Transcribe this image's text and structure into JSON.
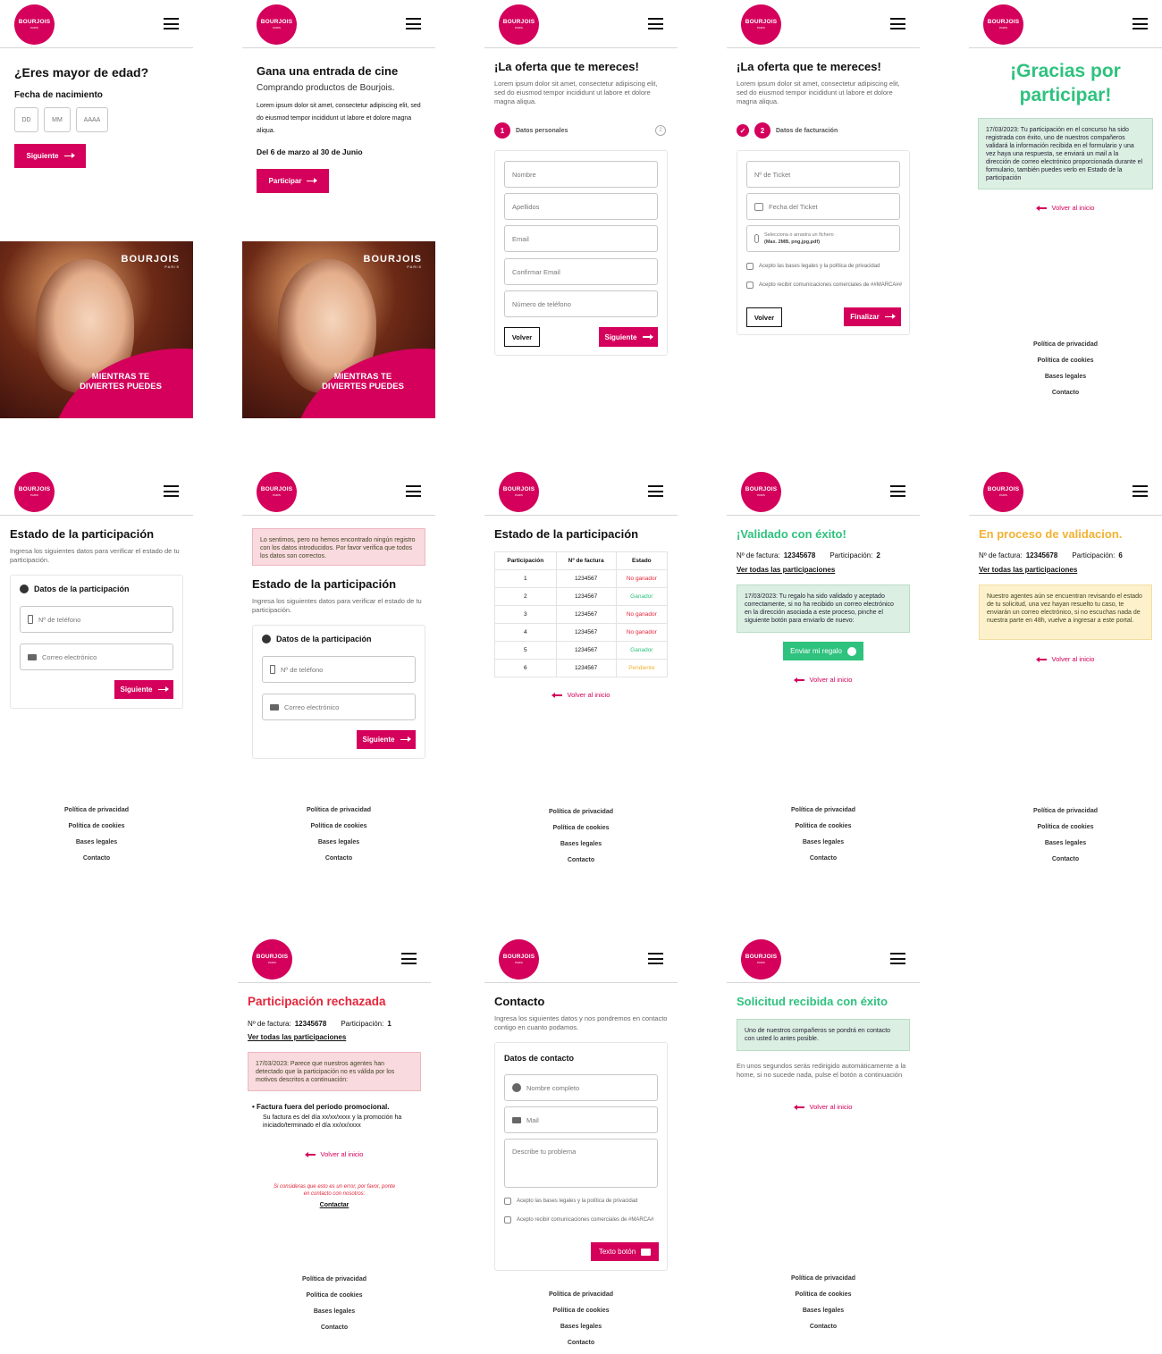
{
  "brand": {
    "logo_text": "BOURJOIS",
    "logo_sub": "PARIS",
    "accent": "#d4005b",
    "success": "#2ec27e",
    "warning": "#f2b233",
    "error": "#e3253a"
  },
  "footer": [
    "Política de privacidad",
    "Política de cookies",
    "Bases legales",
    "Contacto"
  ],
  "back_link": "Volver al inicio",
  "age": {
    "title": "¿Eres mayor de edad?",
    "label": "Fecha de nacimiento",
    "dd": "DD",
    "mm": "MM",
    "aaaa": "AAAA",
    "next": "Siguiente"
  },
  "promo": {
    "brand": "BOURJOIS",
    "brand_sub": "PARIS",
    "slogan": "MIENTRAS TE DIVIERTES PUEDES"
  },
  "cine": {
    "title": "Gana una entrada de cine",
    "subtitle": "Comprando productos de Bourjois.",
    "body": "Lorem ipsum dolor sit amet, consectetur adipiscing elit, sed do eiusmod tempor incididunt ut labore et dolore magna aliqua.",
    "dates": "Del 6 de marzo al 30 de Junio",
    "cta": "Participar"
  },
  "offer": {
    "title": "¡La oferta que te mereces!",
    "body": "Lorem ipsum dolor sit amet, consectetur adipiscing elit, sed do eiusmod tempor incididunt ut labore et dolore magna aliqua.",
    "step1_num": "1",
    "step1_label": "Datos personales",
    "step2_num": "2",
    "step2_label": "Datos de facturación",
    "fields": [
      "Nombre",
      "Apellidos",
      "Email",
      "Confirmar Email",
      "Número de teléfono"
    ],
    "back": "Volver",
    "next": "Siguiente"
  },
  "billing": {
    "ticket": "Nº de Ticket",
    "ticket_date": "Fecha del Ticket",
    "file_line1": "Selecciona o arrastra un fichero",
    "file_line2": "(Max. 2MB, png,jpg,pdf)",
    "legal": "Acepto las bases legales y la política de privacidad",
    "comms": "Acepto recibir comunicaciones comerciales de ##MARCA##",
    "back": "Volver",
    "finish": "Finalizar"
  },
  "thanks": {
    "title": "¡Gracias por participar!",
    "note": "17/03/2023: Tu participación en el concurso ha sido registrada con éxito, uno de nuestros compañeros validará la información recibida en el formulario y una vez haya una respuesta, se enviará un mail a la dirección de correo electrónico proporcionada durante el formulario, también puedes verlo en Estado de la participación"
  },
  "status": {
    "title": "Estado de la participación",
    "body": "Ingresa los siguientes datos para verificar el estado de tu participación.",
    "card_title": "Datos de la participación",
    "phone": "Nº de teléfono",
    "email": "Correo electrónico",
    "next": "Siguiente"
  },
  "status_error": {
    "note": "Lo sentimos, pero no hemos encontrado ningún registro con los datos introducidos. Por favor verifica que todos los datos son correctos."
  },
  "table": {
    "headers": [
      "Participación",
      "Nº de factura",
      "Estado"
    ],
    "rows": [
      [
        "1",
        "1234567",
        "No ganador"
      ],
      [
        "2",
        "1234567",
        "Ganador"
      ],
      [
        "3",
        "1234567",
        "No ganador"
      ],
      [
        "4",
        "1234567",
        "No ganador"
      ],
      [
        "5",
        "1234567",
        "Ganador"
      ],
      [
        "6",
        "1234567",
        "Pendiente"
      ]
    ]
  },
  "validated": {
    "title": "¡Validado con éxito!",
    "invoice_label": "Nº de factura:",
    "invoice": "12345678",
    "part_label": "Participación:",
    "part": "2",
    "see_all": "Ver todas las participaciones",
    "note": "17/03/2023: Tu regalo ha sido validado y aceptado correctamente, si no ha recibido un correo electrónico en la dirección asociada a este proceso, pinche el siguiente botón para enviarlo de nuevo:",
    "send": "Enviar mi regalo"
  },
  "pending": {
    "title": "En proceso de validacion.",
    "invoice_label": "Nº de factura:",
    "invoice": "12345678",
    "part_label": "Participación:",
    "part": "6",
    "see_all": "Ver todas las participaciones",
    "note": "Nuestro agentes aún se encuentran revisando el estado de tu solicitud, una vez hayan resuelto tu caso, te enviarán un correo electrónico, si no escuchas nada de nuestra parte en 48h, vuelve a ingresar a este portal."
  },
  "rejected": {
    "title": "Participación rechazada",
    "invoice_label": "Nº de factura:",
    "invoice": "12345678",
    "part_label": "Participación:",
    "part": "1",
    "see_all": "Ver todas las participaciones",
    "note": "17/03/2023: Parece que nuestros agentes han detectado que la participación no es válida por los motivos descritos a continuación:",
    "reason_title": "Factura fuera del periodo promocional.",
    "reason_body": "Su factura es del día xx/xx/xxxx y la promoción ha iniciado/terminado el día xx/xx/xxxx",
    "error_msg": "Si consideras que esto es un error, por favor, ponte en contacto con nosotros:",
    "contact": "Contactar"
  },
  "contact": {
    "title": "Contacto",
    "body": "Ingresa los siguientes datos y nos pondremos en contacto contigo en cuanto podamos.",
    "card_title": "Datos de contacto",
    "name": "Nombre completo",
    "mail": "Mail",
    "problem": "Describe tu problema",
    "legal": "Acepto las bases legales y la política de privacidad",
    "comms": "Acepto recibir comunicaciones comerciales de #MARCA#",
    "send": "Texto botón"
  },
  "received": {
    "title": "Solicitud recibida con éxito",
    "note": "Uno de nuestros compañeros se pondrá en contacto con usted lo antes posible.",
    "body": "En unos segundos serás redirigido automáticamente a la home, si no sucede nada, pulse el botón a continuación"
  }
}
